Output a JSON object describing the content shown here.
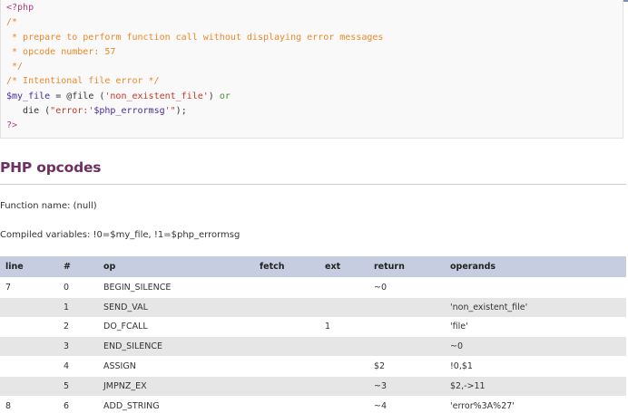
{
  "code": {
    "lines": [
      {
        "parts": [
          {
            "cls": "c-tag",
            "text": "<?php"
          }
        ]
      },
      {
        "parts": [
          {
            "cls": "c-comment",
            "text": "/*"
          }
        ]
      },
      {
        "parts": [
          {
            "cls": "c-comment",
            "text": " * prepare to perform function call without displaying error messages"
          }
        ]
      },
      {
        "parts": [
          {
            "cls": "c-comment",
            "text": " * opcode number: 57"
          }
        ]
      },
      {
        "parts": [
          {
            "cls": "c-comment",
            "text": " */"
          }
        ]
      },
      {
        "parts": [
          {
            "cls": "c-comment",
            "text": "/* Intentional file error */"
          }
        ]
      },
      {
        "parts": [
          {
            "cls": "c-var",
            "text": "$my_file"
          },
          {
            "cls": "c-plain",
            "text": " = @file ("
          },
          {
            "cls": "c-str",
            "text": "'non_existent_file'"
          },
          {
            "cls": "c-plain",
            "text": ") "
          },
          {
            "cls": "c-kw",
            "text": "or"
          }
        ]
      },
      {
        "parts": [
          {
            "cls": "c-plain",
            "text": "   die ("
          },
          {
            "cls": "c-str",
            "text": "\"error:'"
          },
          {
            "cls": "c-var",
            "text": "$php_errormsg"
          },
          {
            "cls": "c-str",
            "text": "'\""
          },
          {
            "cls": "c-plain",
            "text": ");"
          }
        ]
      },
      {
        "parts": [
          {
            "cls": "c-tag",
            "text": "?>"
          }
        ]
      }
    ]
  },
  "section": {
    "title": "PHP opcodes"
  },
  "info": {
    "function_name": "Function name: (null)",
    "compiled_vars": "Compiled variables: !0=$my_file, !1=$php_errormsg"
  },
  "table": {
    "headers": {
      "line": "line",
      "num": "#",
      "op": "op",
      "fetch": "fetch",
      "ext": "ext",
      "return": "return",
      "operands": "operands"
    },
    "rows": [
      {
        "line": "7",
        "num": "0",
        "op": "BEGIN_SILENCE",
        "fetch": "",
        "ext": "",
        "return": "~0",
        "operands": ""
      },
      {
        "line": "",
        "num": "1",
        "op": "SEND_VAL",
        "fetch": "",
        "ext": "",
        "return": "",
        "operands": "'non_existent_file'"
      },
      {
        "line": "",
        "num": "2",
        "op": "DO_FCALL",
        "fetch": "",
        "ext": "1",
        "return": "",
        "operands": "'file'"
      },
      {
        "line": "",
        "num": "3",
        "op": "END_SILENCE",
        "fetch": "",
        "ext": "",
        "return": "",
        "operands": "~0"
      },
      {
        "line": "",
        "num": "4",
        "op": "ASSIGN",
        "fetch": "",
        "ext": "",
        "return": "$2",
        "operands": "!0,$1"
      },
      {
        "line": "",
        "num": "5",
        "op": "JMPNZ_EX",
        "fetch": "",
        "ext": "",
        "return": "~3",
        "operands": "$2,->11"
      },
      {
        "line": "8",
        "num": "6",
        "op": "ADD_STRING",
        "fetch": "",
        "ext": "",
        "return": "~4",
        "operands": "'error%3A%27'"
      }
    ]
  }
}
